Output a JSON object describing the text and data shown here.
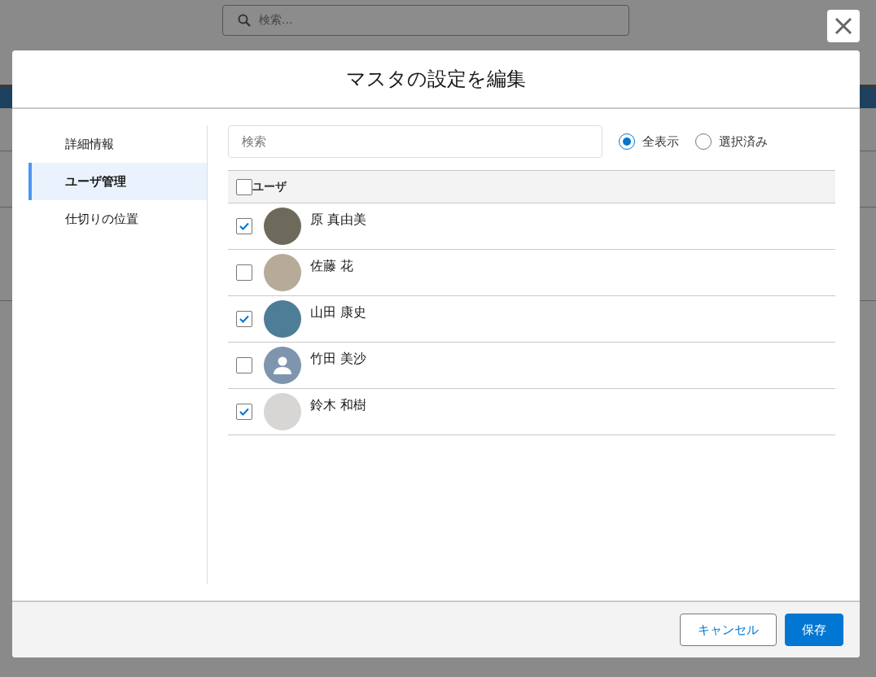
{
  "background": {
    "search": {
      "placeholder": "検索..."
    }
  },
  "dialog": {
    "title": "マスタの設定を編集",
    "sidebar": {
      "items": [
        {
          "label": "詳細情報",
          "selected": false
        },
        {
          "label": "ユーザ管理",
          "selected": true
        },
        {
          "label": "仕切りの位置",
          "selected": false
        }
      ]
    },
    "search": {
      "placeholder": "検索"
    },
    "filters": [
      {
        "label": "全表示",
        "selected": true
      },
      {
        "label": "選択済み",
        "selected": false
      }
    ],
    "table": {
      "select_all": {
        "checked": false
      },
      "column": "ユーザ",
      "rows": [
        {
          "name": "原 真由美",
          "checked": true,
          "kind": "photo"
        },
        {
          "name": "佐藤 花",
          "checked": false,
          "kind": "photo"
        },
        {
          "name": "山田 康史",
          "checked": true,
          "kind": "photo"
        },
        {
          "name": "竹田 美沙",
          "checked": false,
          "kind": "default"
        },
        {
          "name": "鈴木 和樹",
          "checked": true,
          "kind": "photo"
        }
      ]
    },
    "buttons": [
      {
        "label": "キャンセル",
        "kind": "secondary"
      },
      {
        "label": "保存",
        "kind": "primary"
      }
    ]
  }
}
